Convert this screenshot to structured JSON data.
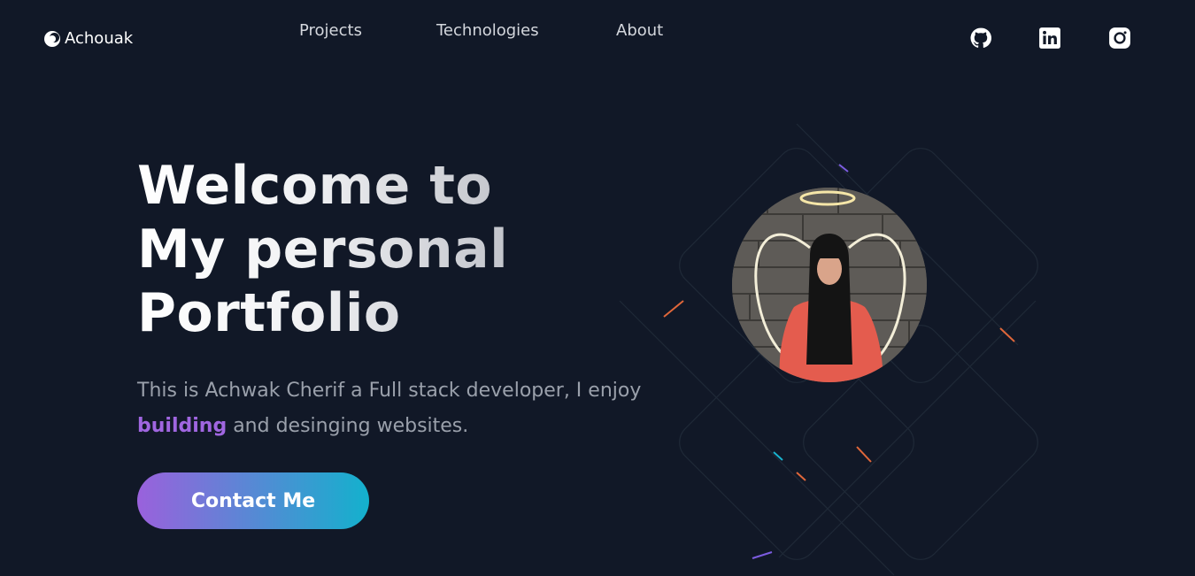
{
  "brand": {
    "name": "Achouak",
    "icon": "logo-mark-icon"
  },
  "nav": {
    "items": [
      "Projects",
      "Technologies",
      "About"
    ]
  },
  "social": {
    "github": "github-icon",
    "linkedin": "linkedin-icon",
    "instagram": "instagram-icon"
  },
  "hero": {
    "title_lines": [
      "Welcome to",
      "My personal",
      "Portfolio"
    ],
    "description_part1": "This is Achwak Cherif a Full stack developer, I enjoy",
    "description_highlight": "building",
    "description_part2": " and desinging websites.",
    "cta_label": "Contact Me"
  },
  "colors": {
    "background": "#111827",
    "highlight": "#a066e0",
    "cta_gradient_start": "#9a61dc",
    "cta_gradient_end": "#13b1cd"
  }
}
